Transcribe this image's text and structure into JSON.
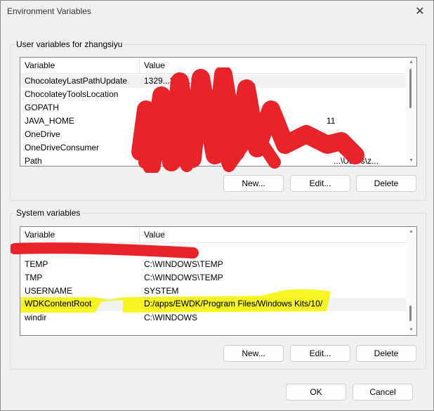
{
  "window": {
    "title": "Environment Variables",
    "close_glyph": "✕"
  },
  "user_group": {
    "label": "User variables for zhangsiyu",
    "col_variable": "Variable",
    "col_value": "Value",
    "rows": [
      {
        "name": "ChocolateyLastPathUpdate",
        "value": "1329...316...58"
      },
      {
        "name": "ChocolateyToolsLocation",
        "value": ""
      },
      {
        "name": "GOPATH",
        "value": ""
      },
      {
        "name": "JAVA_HOME",
        "value": "11"
      },
      {
        "name": "OneDrive",
        "value": ""
      },
      {
        "name": "OneDriveConsumer",
        "value": ""
      },
      {
        "name": "Path",
        "value": "...\\Users\\z..."
      }
    ],
    "new_label": "New...",
    "edit_label": "Edit...",
    "delete_label": "Delete"
  },
  "system_group": {
    "label": "System variables",
    "col_variable": "Variable",
    "col_value": "Value",
    "rows": [
      {
        "name": "",
        "value": ""
      },
      {
        "name": "TEMP",
        "value": "C:\\WINDOWS\\TEMP"
      },
      {
        "name": "TMP",
        "value": "C:\\WINDOWS\\TEMP"
      },
      {
        "name": "USERNAME",
        "value": "SYSTEM"
      },
      {
        "name": "WDKContentRoot",
        "value": "D:/apps/EWDK/Program Files/Windows Kits/10/"
      },
      {
        "name": "windir",
        "value": "C:\\WINDOWS"
      }
    ],
    "new_label": "New...",
    "edit_label": "Edit...",
    "delete_label": "Delete"
  },
  "footer": {
    "ok_label": "OK",
    "cancel_label": "Cancel"
  },
  "colors": {
    "redaction": "#e8232a",
    "highlight": "#f5f500",
    "list_border": "#828790",
    "background": "#f0f0f0"
  }
}
